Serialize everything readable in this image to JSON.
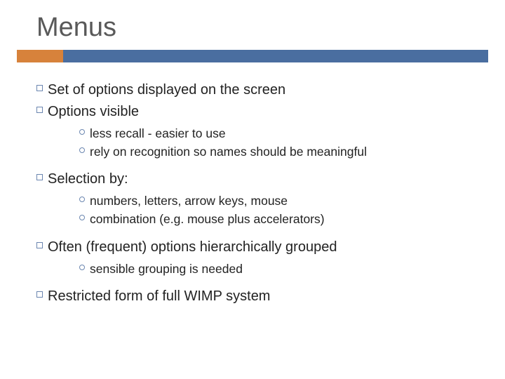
{
  "title": "Menus",
  "items": [
    {
      "text": "Set of options displayed on the screen"
    },
    {
      "text": "Options visible",
      "sub": [
        "less recall - easier to use",
        "rely on recognition so names should be meaningful"
      ]
    },
    {
      "text": "Selection by:",
      "sub": [
        "numbers, letters, arrow keys, mouse",
        "combination  (e.g. mouse plus accelerators)"
      ]
    },
    {
      "text": "Often (frequent) options hierarchically grouped",
      "sub": [
        "sensible grouping is needed"
      ]
    },
    {
      "text": "Restricted form of full WIMP system"
    }
  ]
}
